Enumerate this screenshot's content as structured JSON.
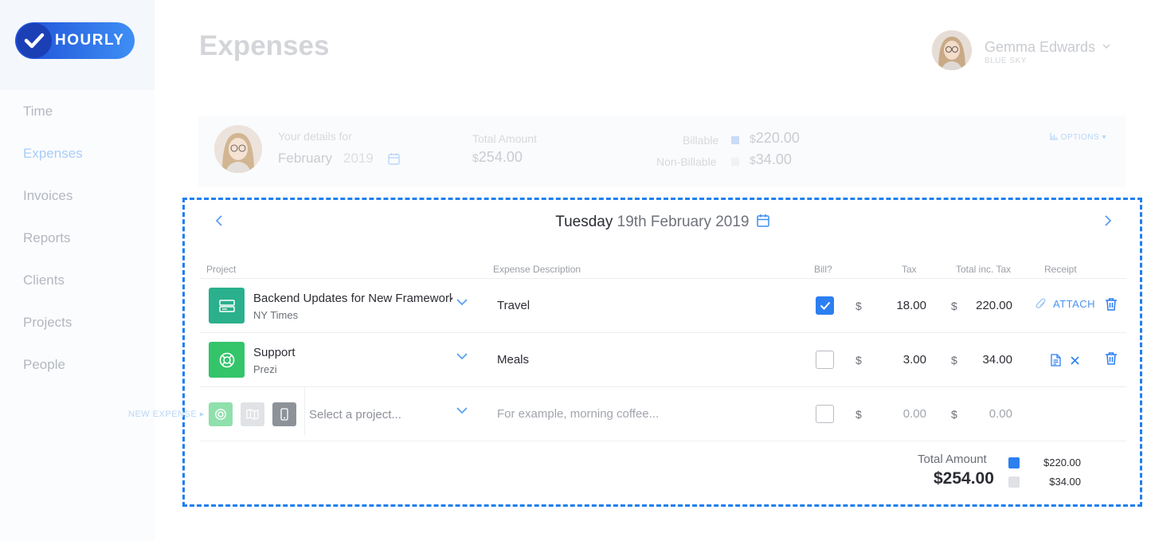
{
  "brand": {
    "name": "HOURLY"
  },
  "sidebar": {
    "items": [
      {
        "label": "Time",
        "active": false
      },
      {
        "label": "Expenses",
        "active": true
      },
      {
        "label": "Invoices",
        "active": false
      },
      {
        "label": "Reports",
        "active": false
      },
      {
        "label": "Clients",
        "active": false
      },
      {
        "label": "Projects",
        "active": false
      },
      {
        "label": "People",
        "active": false
      }
    ]
  },
  "header": {
    "title": "Expenses",
    "user": {
      "name": "Gemma Edwards",
      "org": "BLUE SKY"
    }
  },
  "summary": {
    "details_label": "Your details for",
    "month": "February",
    "year": "2019",
    "total_label": "Total Amount",
    "total_currency": "$",
    "total_value": "254.00",
    "billable_label": "Billable",
    "billable_currency": "$",
    "billable_value": "220.00",
    "nonbillable_label": "Non-Billable",
    "nonbillable_currency": "$",
    "nonbillable_value": "34.00",
    "options_label": "OPTIONS",
    "colors": {
      "billable": "#c9dcf8",
      "nonbillable": "#f1f2f4"
    }
  },
  "day": {
    "weekday": "Tuesday",
    "date": "19th February 2019"
  },
  "table": {
    "headers": {
      "project": "Project",
      "description": "Expense Description",
      "bill": "Bill?",
      "tax": "Tax",
      "total": "Total inc. Tax",
      "receipt": "Receipt"
    },
    "rows": [
      {
        "project": "Backend Updates for New Framework",
        "client": "NY Times",
        "icon": "server-icon",
        "icon_color": "#2ab08c",
        "description": "Travel",
        "billable": true,
        "tax_currency": "$",
        "tax": "18.00",
        "total_currency": "$",
        "total": "220.00",
        "receipt_action": "ATTACH"
      },
      {
        "project": "Support",
        "client": "Prezi",
        "icon": "lifebuoy-icon",
        "icon_color": "#34c46a",
        "description": "Meals",
        "billable": false,
        "tax_currency": "$",
        "tax": "3.00",
        "total_currency": "$",
        "total": "34.00",
        "receipt_action": ""
      }
    ],
    "new_row": {
      "label": "NEW EXPENSE",
      "project_placeholder": "Select a project...",
      "description_placeholder": "For example, morning coffee...",
      "tax_currency": "$",
      "tax_placeholder": "0.00",
      "total_currency": "$",
      "total_placeholder": "0.00"
    }
  },
  "totals": {
    "label": "Total Amount",
    "value": "$254.00",
    "billable": "$220.00",
    "nonbillable": "$34.00",
    "colors": {
      "billable": "#2b7ff0",
      "nonbillable": "#dfe1e5"
    }
  }
}
